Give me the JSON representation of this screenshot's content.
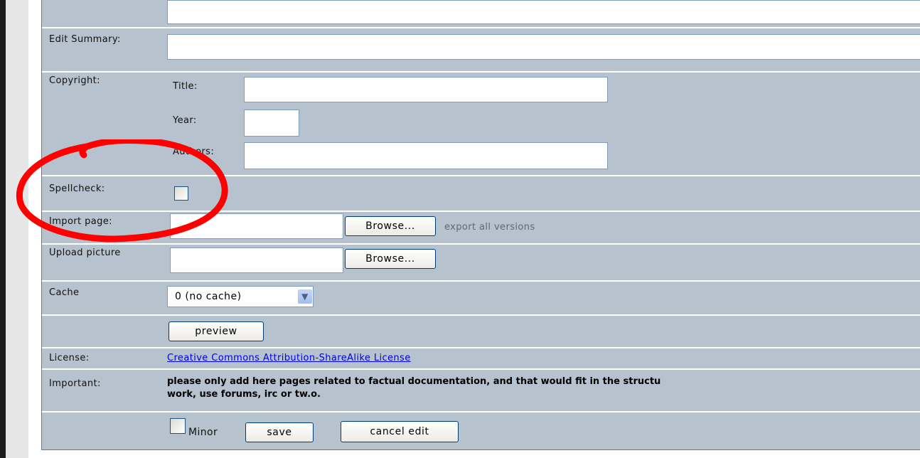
{
  "form": {
    "edit_summary_label": "Edit Summary:",
    "copyright_label": "Copyright:",
    "copyright_title_label": "Title:",
    "copyright_year_label": "Year:",
    "copyright_authors_label": "Authors:",
    "spellcheck_label": "Spellcheck:",
    "import_page_label": "Import page:",
    "import_browse_label": "Browse...",
    "export_all_versions_label": "export all versions",
    "upload_picture_label": "Upload picture",
    "upload_browse_label": "Browse...",
    "cache_label": "Cache",
    "cache_selected": "0 (no cache)",
    "preview_label": "preview",
    "license_label": "License:",
    "license_link": "Creative Commons Attribution-ShareAlike License",
    "important_label": "Important:",
    "important_line1": "please only add here pages related to factual documentation, and that would fit in the structu",
    "important_line2": "work, use forums, irc or tw.o.",
    "minor_label": "Minor",
    "save_label": "save",
    "cancel_label": "cancel edit"
  },
  "colors": {
    "row_bg": "#b6c2cd",
    "annotation": "#ff0000",
    "link": "#0000ee"
  }
}
